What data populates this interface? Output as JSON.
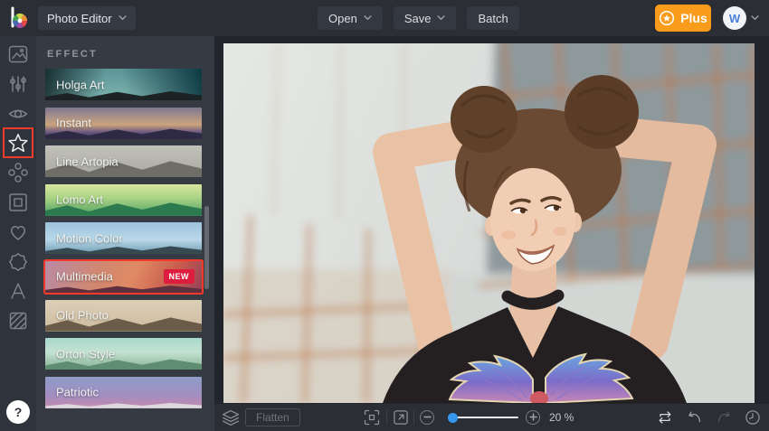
{
  "topbar": {
    "app_menu_label": "Photo Editor",
    "open_label": "Open",
    "save_label": "Save",
    "batch_label": "Batch",
    "plus_label": "Plus",
    "avatar_initial": "W"
  },
  "sidebar": {
    "icons": [
      "image",
      "adjustments",
      "eye",
      "star",
      "artsy",
      "frame",
      "heart",
      "badge-seal",
      "text",
      "texture"
    ],
    "selected_icon": "star",
    "help_label": "?"
  },
  "panel": {
    "header": "EFFECT",
    "effects": [
      {
        "label": "Holga Art"
      },
      {
        "label": "Instant"
      },
      {
        "label": "Line Artopia"
      },
      {
        "label": "Lomo Art"
      },
      {
        "label": "Motion Color"
      },
      {
        "label": "Multimedia",
        "badge": "NEW",
        "selected": true
      },
      {
        "label": "Old Photo"
      },
      {
        "label": "Orton Style"
      },
      {
        "label": "Patriotic"
      }
    ]
  },
  "toolbar": {
    "flatten_label": "Flatten",
    "zoom_value": "20 %",
    "icons": [
      "layers",
      "fit-screen",
      "open-in-new",
      "zoom-out",
      "zoom-slider",
      "zoom-in",
      "compare",
      "undo",
      "redo",
      "history"
    ]
  },
  "colors": {
    "accent-orange": "#f99b1b",
    "selection-red": "#f23a2b",
    "badge-red": "#dc1d3e",
    "avatar-blue": "#4a80d9",
    "slider-blue": "#3598ef"
  }
}
